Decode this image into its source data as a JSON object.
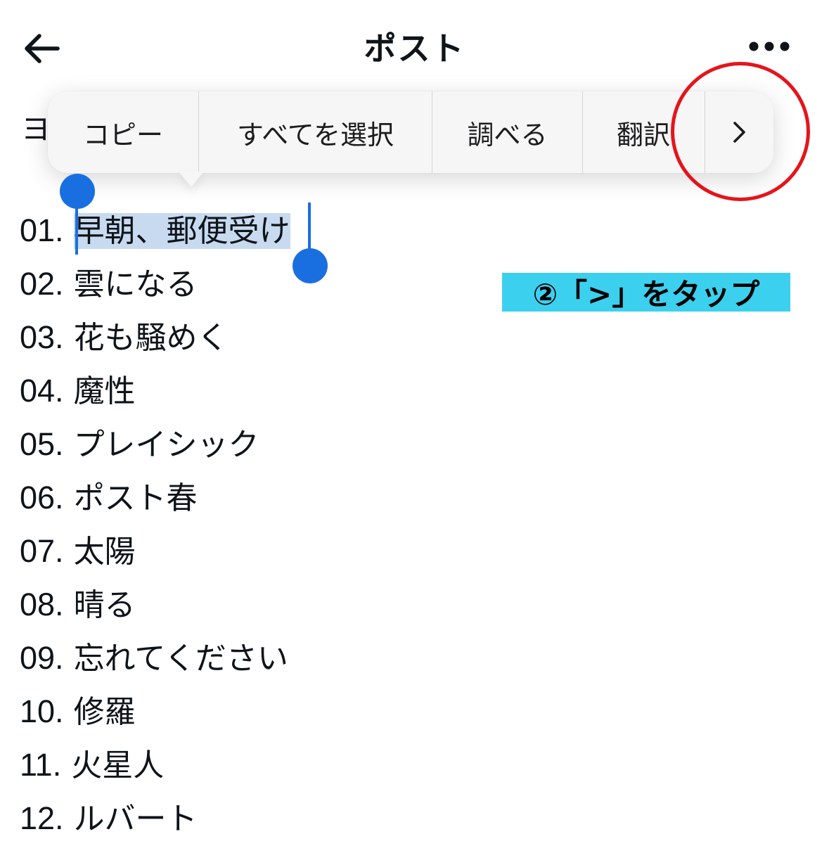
{
  "header": {
    "back_icon": "arrow-left-icon",
    "title": "ポスト",
    "more_icon": "more-horizontal-icon"
  },
  "hidden_text": "ヨ",
  "context_menu": {
    "items": [
      {
        "label": "コピー"
      },
      {
        "label": "すべてを選択"
      },
      {
        "label": "調べる"
      },
      {
        "label": "翻訳"
      }
    ],
    "next_label": ">",
    "next_icon": "chevron-right-icon"
  },
  "annotation": {
    "text": "②「>」をタップ",
    "color": "#3cd0ef",
    "highlight_color": "#e5141b"
  },
  "selection": {
    "color": "#1a6fe0",
    "background": "#c7daf0"
  },
  "tracks": [
    {
      "num": "01.",
      "title": "早朝、郵便受け"
    },
    {
      "num": "02.",
      "title": "雲になる"
    },
    {
      "num": "03.",
      "title": "花も騒めく"
    },
    {
      "num": "04.",
      "title": "魔性"
    },
    {
      "num": "05.",
      "title": "プレイシック"
    },
    {
      "num": "06.",
      "title": "ポスト春"
    },
    {
      "num": "07.",
      "title": "太陽"
    },
    {
      "num": "08.",
      "title": "晴る"
    },
    {
      "num": "09.",
      "title": "忘れてください"
    },
    {
      "num": "10.",
      "title": "修羅"
    },
    {
      "num": "11.",
      "title": "火星人"
    },
    {
      "num": "12.",
      "title": "ルバート"
    }
  ]
}
